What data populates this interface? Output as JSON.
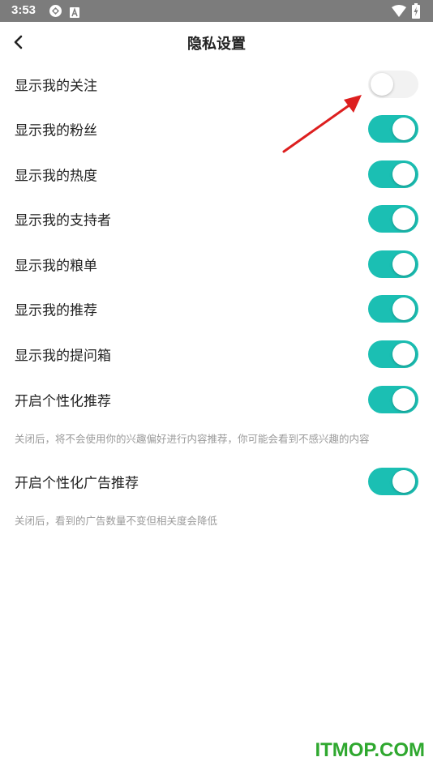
{
  "status_bar": {
    "time": "3:53",
    "icons": [
      "sync-icon",
      "font-a-icon",
      "wifi-icon",
      "battery-charging-icon"
    ]
  },
  "header": {
    "title": "隐私设置",
    "back_icon": "chevron-left-icon"
  },
  "settings": [
    {
      "label": "显示我的关注",
      "enabled": false
    },
    {
      "label": "显示我的粉丝",
      "enabled": true
    },
    {
      "label": "显示我的热度",
      "enabled": true
    },
    {
      "label": "显示我的支持者",
      "enabled": true
    },
    {
      "label": "显示我的粮单",
      "enabled": true
    },
    {
      "label": "显示我的推荐",
      "enabled": true
    },
    {
      "label": "显示我的提问箱",
      "enabled": true
    },
    {
      "label": "开启个性化推荐",
      "enabled": true,
      "note": "关闭后，将不会使用你的兴趣偏好进行内容推荐，你可能会看到不感兴趣的内容"
    },
    {
      "label": "开启个性化广告推荐",
      "enabled": true,
      "note": "关闭后，看到的广告数量不变但相关度会降低"
    }
  ],
  "colors": {
    "toggle_on": "#1bbfb3",
    "toggle_off": "#f2f2f2",
    "annotation_arrow": "#dd1f1f",
    "watermark": "#2fa82f"
  },
  "watermark": "ITMOP.COM"
}
